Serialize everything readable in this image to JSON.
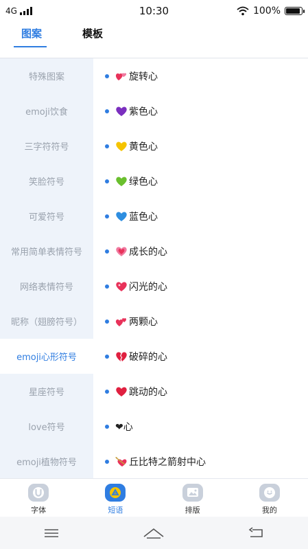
{
  "status": {
    "network": "4G",
    "time": "10:30",
    "battery": "100%"
  },
  "tabs": [
    {
      "label": "图案",
      "active": true
    },
    {
      "label": "模板",
      "active": false
    }
  ],
  "sidebar": {
    "items": [
      {
        "label": "特殊图案"
      },
      {
        "label": "emoji饮食"
      },
      {
        "label": "三字符符号"
      },
      {
        "label": "笑脸符号"
      },
      {
        "label": "可爱符号"
      },
      {
        "label": "常用简单表情符号"
      },
      {
        "label": "网络表情符号"
      },
      {
        "label": "昵称（翅膀符号）"
      },
      {
        "label": "emoji心形符号",
        "active": true
      },
      {
        "label": "星座符号"
      },
      {
        "label": "love符号"
      },
      {
        "label": "emoji植物符号"
      }
    ]
  },
  "list": {
    "items": [
      {
        "label": "旋转心",
        "icon": "revolving-hearts-icon"
      },
      {
        "label": "紫色心",
        "icon": "purple-heart-icon",
        "color": "#7b2fbf"
      },
      {
        "label": "黄色心",
        "icon": "yellow-heart-icon",
        "color": "#f5c400"
      },
      {
        "label": "绿色心",
        "icon": "green-heart-icon",
        "color": "#6abf2e"
      },
      {
        "label": "蓝色心",
        "icon": "blue-heart-icon",
        "color": "#2e8ee0"
      },
      {
        "label": "成长的心",
        "icon": "growing-heart-icon",
        "color": "#f07aa0"
      },
      {
        "label": "闪光的心",
        "icon": "sparkling-heart-icon",
        "color": "#e8325a"
      },
      {
        "label": "两颗心",
        "icon": "two-hearts-icon",
        "color": "#e8325a"
      },
      {
        "label": "破碎的心",
        "icon": "broken-heart-icon",
        "color": "#e02040"
      },
      {
        "label": "跳动的心",
        "icon": "beating-heart-icon",
        "color": "#e02040"
      },
      {
        "label": "❤心",
        "icon": "black-heart-icon",
        "color": "#111111"
      },
      {
        "label": "丘比特之箭射中心",
        "icon": "heart-with-arrow-icon",
        "color": "#e8325a"
      }
    ]
  },
  "bottom_nav": {
    "items": [
      {
        "label": "字体",
        "icon": "font-icon"
      },
      {
        "label": "短语",
        "icon": "phrase-icon",
        "active": true
      },
      {
        "label": "排版",
        "icon": "layout-icon"
      },
      {
        "label": "我的",
        "icon": "profile-icon"
      }
    ]
  },
  "colors": {
    "accent": "#2f7de1",
    "sidebar_bg": "#eef3fa",
    "muted_text": "#9aa2ad"
  }
}
